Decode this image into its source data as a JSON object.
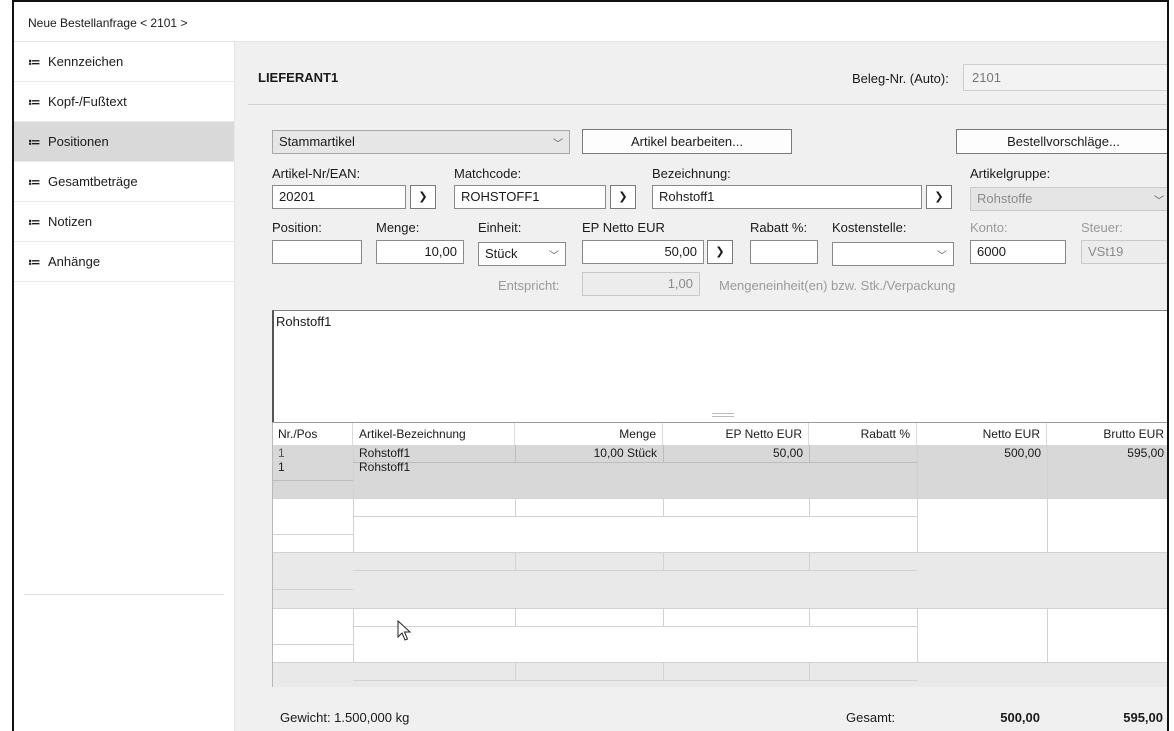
{
  "window": {
    "title": "Neue Bestellanfrage < 2101 >"
  },
  "sidebar": {
    "items": [
      {
        "label": "Kennzeichen",
        "active": false
      },
      {
        "label": "Kopf-/Fußtext",
        "active": false
      },
      {
        "label": "Positionen",
        "active": true
      },
      {
        "label": "Gesamtbeträge",
        "active": false
      },
      {
        "label": "Notizen",
        "active": false
      },
      {
        "label": "Anhänge",
        "active": false
      }
    ],
    "icon": "≔"
  },
  "header": {
    "supplier": "LIEFERANT1",
    "beleg_label": "Beleg-Nr. (Auto):",
    "beleg_value": "2101"
  },
  "toolbar": {
    "article_type": "Stammartikel",
    "edit_article": "Artikel bearbeiten...",
    "order_suggestions": "Bestellvorschläge..."
  },
  "form": {
    "artikelnr_label": "Artikel-Nr/EAN:",
    "artikelnr_value": "20201",
    "matchcode_label": "Matchcode:",
    "matchcode_value": "ROHSTOFF1",
    "bezeichnung_label": "Bezeichnung:",
    "bezeichnung_value": "Rohstoff1",
    "artikelgruppe_label": "Artikelgruppe:",
    "artikelgruppe_value": "Rohstoffe",
    "position_label": "Position:",
    "position_value": "",
    "menge_label": "Menge:",
    "menge_value": "10,00",
    "einheit_label": "Einheit:",
    "einheit_value": "Stück",
    "ep_label": "EP Netto EUR",
    "ep_value": "50,00",
    "rabatt_label": "Rabatt %:",
    "rabatt_value": "",
    "kostenstelle_label": "Kostenstelle:",
    "kostenstelle_value": "",
    "konto_label": "Konto:",
    "konto_value": "6000",
    "steuer_label": "Steuer:",
    "steuer_value": "VSt19",
    "entspricht_label": "Entspricht:",
    "entspricht_value": "1,00",
    "entspricht_text": "Mengeneinheit(en) bzw. Stk./Verpackung"
  },
  "memo": {
    "text": "Rohstoff1"
  },
  "grid": {
    "columns": [
      "Nr./Pos",
      "Artikel-Bezeichnung",
      "Menge",
      "EP Netto EUR",
      "Rabatt %",
      "Netto EUR",
      "Brutto EUR"
    ],
    "rows": [
      {
        "nr": "1",
        "pos": "1",
        "bezeichnung": "Rohstoff1",
        "bezeichnung2": "Rohstoff1",
        "menge": "10,00 Stück",
        "ep": "50,00",
        "rabatt": "",
        "netto": "500,00",
        "brutto": "595,00"
      }
    ]
  },
  "footer": {
    "gewicht": "Gewicht: 1.500,000 kg",
    "gesamt_label": "Gesamt:",
    "gesamt_netto": "500,00",
    "gesamt_brutto": "595,00"
  }
}
